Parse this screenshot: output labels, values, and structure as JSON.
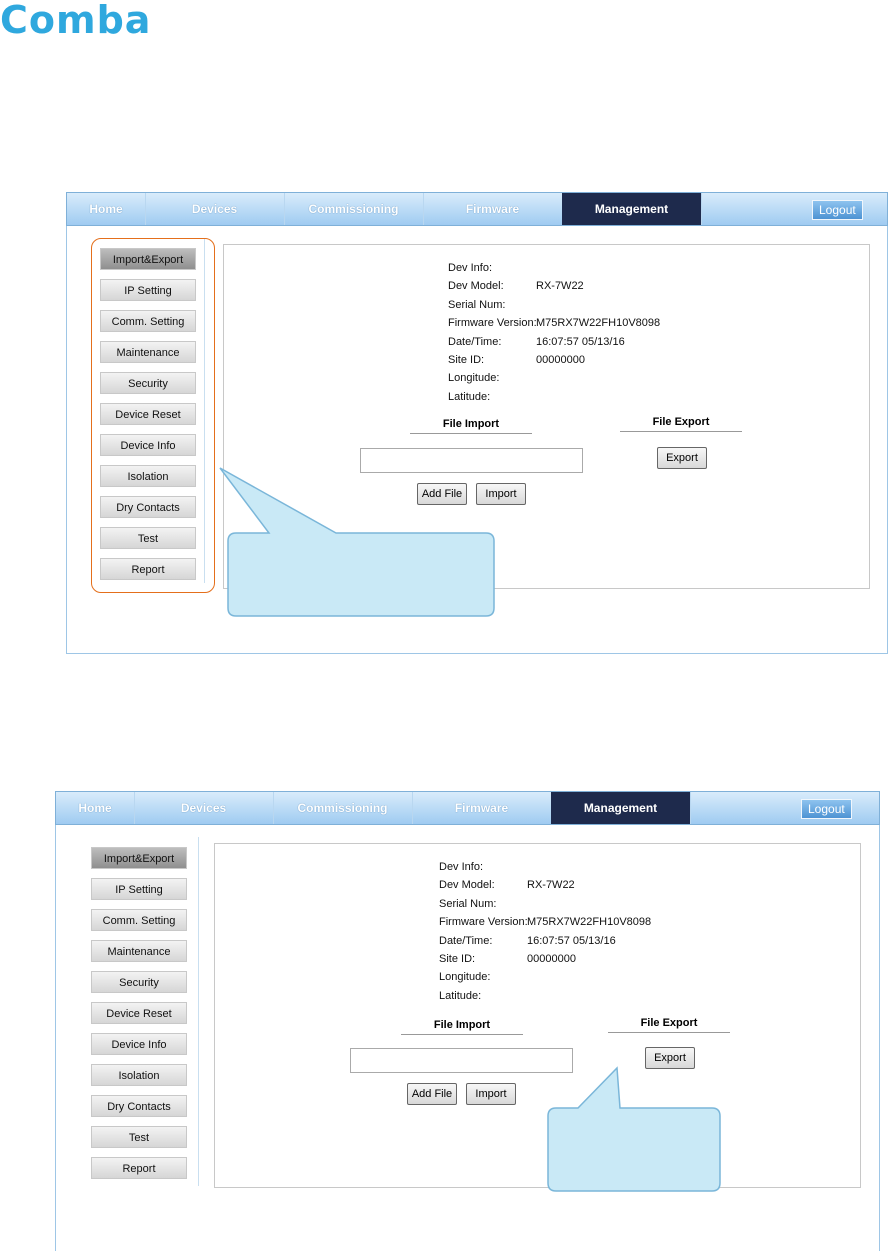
{
  "brand": {
    "logo_text": "Comba",
    "color": "#2fa8de"
  },
  "nav": {
    "tabs": [
      "Home",
      "Devices",
      "Commissioning",
      "Firmware",
      "Management"
    ],
    "active_tab": "Management",
    "logout_label": "Logout",
    "active_color": "#1e2a4c"
  },
  "sidebar": {
    "items": [
      "Import&Export",
      "IP Setting",
      "Comm. Setting",
      "Maintenance",
      "Security",
      "Device Reset",
      "Device Info",
      "Isolation",
      "Dry Contacts",
      "Test",
      "Report"
    ],
    "selected": "Import&Export"
  },
  "dev_info": {
    "title": "Dev Info:",
    "fields": [
      {
        "label": "Dev Model:",
        "value": "RX-7W22"
      },
      {
        "label": "Serial Num:",
        "value": ""
      },
      {
        "label": "Firmware Version:",
        "value": "M75RX7W22FH10V8098"
      },
      {
        "label": "Date/Time:",
        "value": "16:07:57 05/13/16"
      },
      {
        "label": "Site ID:",
        "value": "00000000"
      },
      {
        "label": "Longitude:",
        "value": ""
      },
      {
        "label": "Latitude:",
        "value": ""
      }
    ]
  },
  "file_import": {
    "heading": "File Import",
    "add_file_label": "Add File",
    "import_label": "Import"
  },
  "file_export": {
    "heading": "File Export",
    "export_label": "Export"
  },
  "highlight_color": "#e46f1b",
  "callout_color": "#c9e9f6"
}
